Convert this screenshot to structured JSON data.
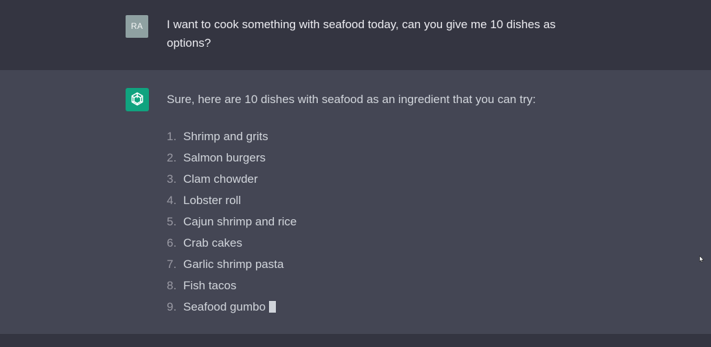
{
  "user_message": {
    "avatar_initials": "RA",
    "text": "I want to cook something with seafood today, can you give me 10 dishes as options?"
  },
  "assistant_message": {
    "avatar_icon": "openai-logo-icon",
    "intro": "Sure, here are 10 dishes with seafood as an ingredient that you can try:",
    "items": [
      {
        "number": "1.",
        "label": "Shrimp and grits"
      },
      {
        "number": "2.",
        "label": "Salmon burgers"
      },
      {
        "number": "3.",
        "label": "Clam chowder"
      },
      {
        "number": "4.",
        "label": "Lobster roll"
      },
      {
        "number": "5.",
        "label": "Cajun shrimp and rice"
      },
      {
        "number": "6.",
        "label": "Crab cakes"
      },
      {
        "number": "7.",
        "label": "Garlic shrimp pasta"
      },
      {
        "number": "8.",
        "label": "Fish tacos"
      },
      {
        "number": "9.",
        "label": "Seafood gumbo"
      }
    ],
    "streaming_cursor": "text-cursor-block"
  },
  "colors": {
    "page_background": "#343541",
    "assistant_row_background": "#444654",
    "user_avatar": "#8fa1a2",
    "assistant_avatar": "#10a37f",
    "primary_text": "#ececf1",
    "secondary_text": "#d1d5db"
  }
}
